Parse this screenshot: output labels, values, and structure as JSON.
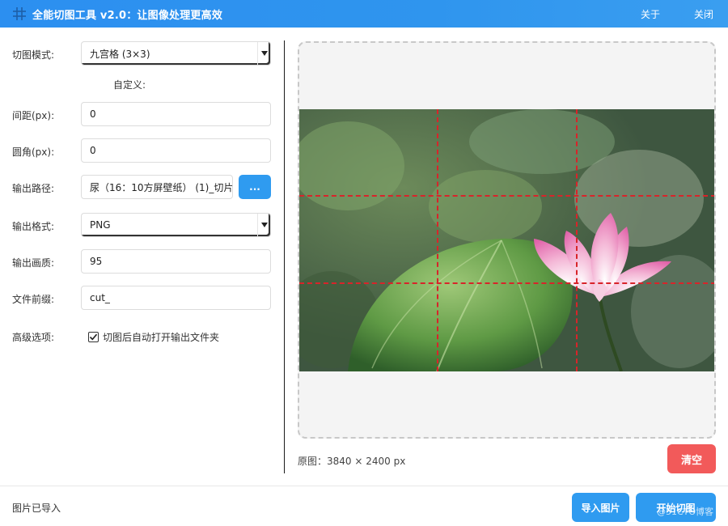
{
  "window": {
    "title": "全能切图工具 v2.0：让图像处理更高效",
    "about_label": "关于",
    "close_label": "关闭",
    "icon": "grid-hash-icon"
  },
  "form": {
    "mode": {
      "label": "切图模式:",
      "value": "九宫格 (3×3)"
    },
    "custom_label": "自定义:",
    "spacing": {
      "label": "间距(px):",
      "value": "0"
    },
    "radius": {
      "label": "圆角(px):",
      "value": "0"
    },
    "output_path": {
      "label": "输出路径:",
      "value": "尿（16：10方屏壁纸） (1)_切片",
      "browse_label": "..."
    },
    "output_format": {
      "label": "输出格式:",
      "value": "PNG"
    },
    "quality": {
      "label": "输出画质:",
      "value": "95"
    },
    "prefix": {
      "label": "文件前缀:",
      "value": "cut_"
    },
    "advanced": {
      "label": "高级选项:",
      "checkbox_label": "切图后自动打开输出文件夹",
      "checked": true
    }
  },
  "preview": {
    "original_info": "原图：3840 × 2400 px",
    "clear_label": "清空",
    "grid_rows": 3,
    "grid_cols": 3,
    "grid_color": "#d8242a"
  },
  "footer": {
    "status": "图片已导入",
    "import_label": "导入图片",
    "start_label": "开始切图",
    "watermark": "@51CTO博客"
  },
  "colors": {
    "accent": "#2f9bf0",
    "danger": "#f25a5a",
    "titlebar": "#2c8ff0"
  }
}
